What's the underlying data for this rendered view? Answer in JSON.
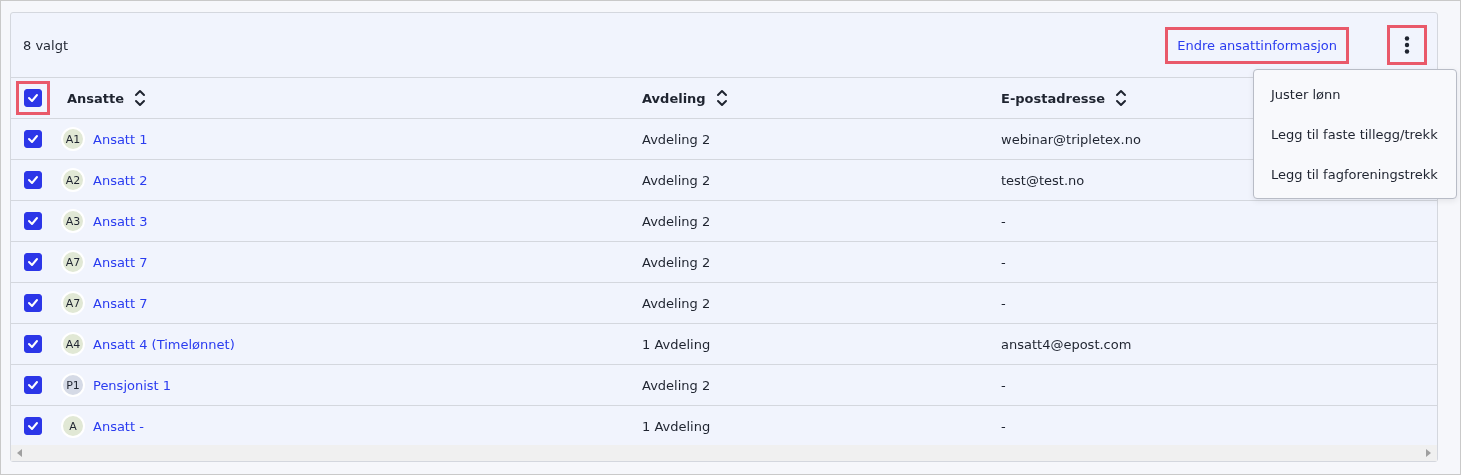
{
  "toolbar": {
    "selection_count": "8 valgt",
    "edit_link": {
      "label": "Endre ansattinformasjon",
      "highlighted": true
    },
    "more_button": {
      "highlighted": true
    }
  },
  "menu": {
    "items": [
      "Juster lønn",
      "Legg til faste tillegg/trekk",
      "Legg til fagforeningstrekk"
    ]
  },
  "table": {
    "select_all": {
      "checked": true,
      "highlighted": true
    },
    "columns": [
      "Ansatte",
      "Avdeling",
      "E-postadresse"
    ],
    "rows": [
      {
        "checked": true,
        "initials": "A1",
        "color": "#e1e8d5",
        "name": "Ansatt 1",
        "department": "Avdeling 2",
        "email": "webinar@tripletex.no"
      },
      {
        "checked": true,
        "initials": "A2",
        "color": "#e1e8d5",
        "name": "Ansatt 2",
        "department": "Avdeling 2",
        "email": "test@test.no"
      },
      {
        "checked": true,
        "initials": "A3",
        "color": "#e1e8d5",
        "name": "Ansatt 3",
        "department": "Avdeling 2",
        "email": "-"
      },
      {
        "checked": true,
        "initials": "A7",
        "color": "#e1e8d5",
        "name": "Ansatt 7",
        "department": "Avdeling 2",
        "email": "-"
      },
      {
        "checked": true,
        "initials": "A7",
        "color": "#e1e8d5",
        "name": "Ansatt 7",
        "department": "Avdeling 2",
        "email": "-"
      },
      {
        "checked": true,
        "initials": "A4",
        "color": "#e1e8d5",
        "name": "Ansatt 4 (Timelønnet)",
        "department": "1 Avdeling",
        "email": "ansatt4@epost.com"
      },
      {
        "checked": true,
        "initials": "P1",
        "color": "#d5dae6",
        "name": "Pensjonist 1",
        "department": "Avdeling 2",
        "email": "-"
      },
      {
        "checked": true,
        "initials": "A",
        "color": "#e1e8d5",
        "name": "Ansatt -",
        "department": "1 Avdeling",
        "email": "-"
      }
    ]
  }
}
